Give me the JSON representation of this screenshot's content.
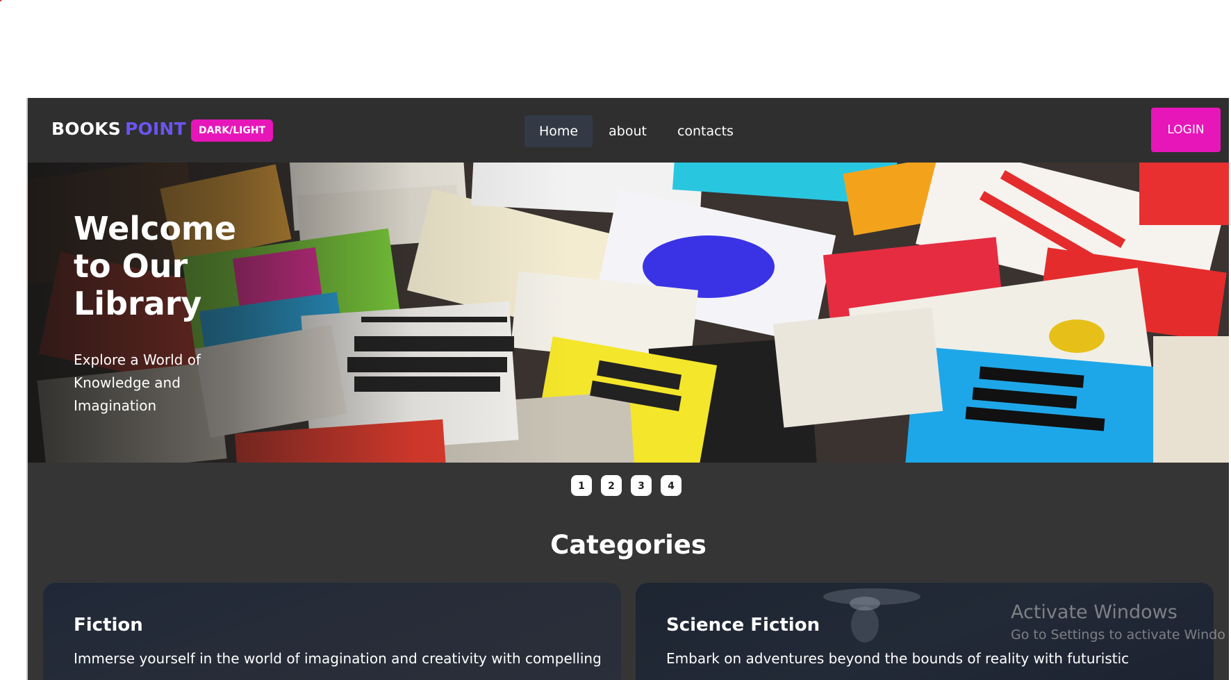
{
  "navbar": {
    "brand_main": "BOOKS",
    "brand_accent": "POINT",
    "theme_toggle_label": "DARK/LIGHT",
    "links": [
      {
        "label": "Home",
        "active": true
      },
      {
        "label": "about",
        "active": false
      },
      {
        "label": "contacts",
        "active": false
      }
    ],
    "login_label": "LOGIN"
  },
  "hero": {
    "title": "Welcome to Our Library",
    "subtitle": "Explore a World of Knowledge and Imagination",
    "pages": [
      "1",
      "2",
      "3",
      "4"
    ]
  },
  "categories": {
    "heading": "Categories",
    "items": [
      {
        "title": "Fiction",
        "description": "Immerse yourself in the world of imagination and creativity with compelling"
      },
      {
        "title": "Science Fiction",
        "description": "Embark on adventures beyond the bounds of reality with futuristic"
      }
    ]
  },
  "watermark": {
    "line1": "Activate Windows",
    "line2": "Go to Settings to activate Windo"
  },
  "colors": {
    "accent_pink": "#e716b9",
    "brand_purple": "#6b55f0",
    "page_bg": "#353535",
    "navbar_bg": "#2f2f2f"
  }
}
